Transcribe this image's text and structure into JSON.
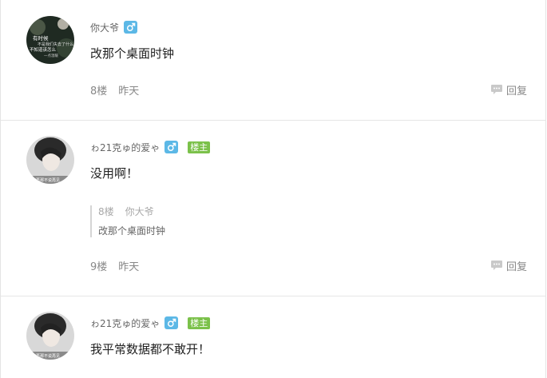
{
  "posts": [
    {
      "username": "你大爷",
      "gender": "male",
      "is_op": false,
      "content": "改那个桌面时钟",
      "floor": "8楼",
      "time": "昨天",
      "reply_label": "回复",
      "avatar_overlay_lines": [
        "有时候",
        "不是我们失去了什么",
        "不知道该怎么",
        "一点温暖"
      ]
    },
    {
      "username": "ゎ21克ゅ的爱ゃ",
      "gender": "male",
      "is_op": true,
      "op_badge": "楼主",
      "content": "没用啊！",
      "quote": {
        "floor": "8楼",
        "username": "你大爷",
        "text": "改那个桌面时钟"
      },
      "floor": "9楼",
      "time": "昨天",
      "reply_label": "回复",
      "avatar_overlay_text": "再不再那不说再见"
    },
    {
      "username": "ゎ21克ゅ的爱ゃ",
      "gender": "male",
      "is_op": true,
      "op_badge": "楼主",
      "content": "我平常数据都不敢开！",
      "avatar_overlay_text": "再不再那不说再见"
    }
  ],
  "colors": {
    "gender_male": "#5cb8e6",
    "op_badge": "#7bc14a",
    "divider": "#e6e6e6"
  },
  "icons": {
    "gender": "male-symbol-icon",
    "reply": "speech-bubble-icon"
  }
}
